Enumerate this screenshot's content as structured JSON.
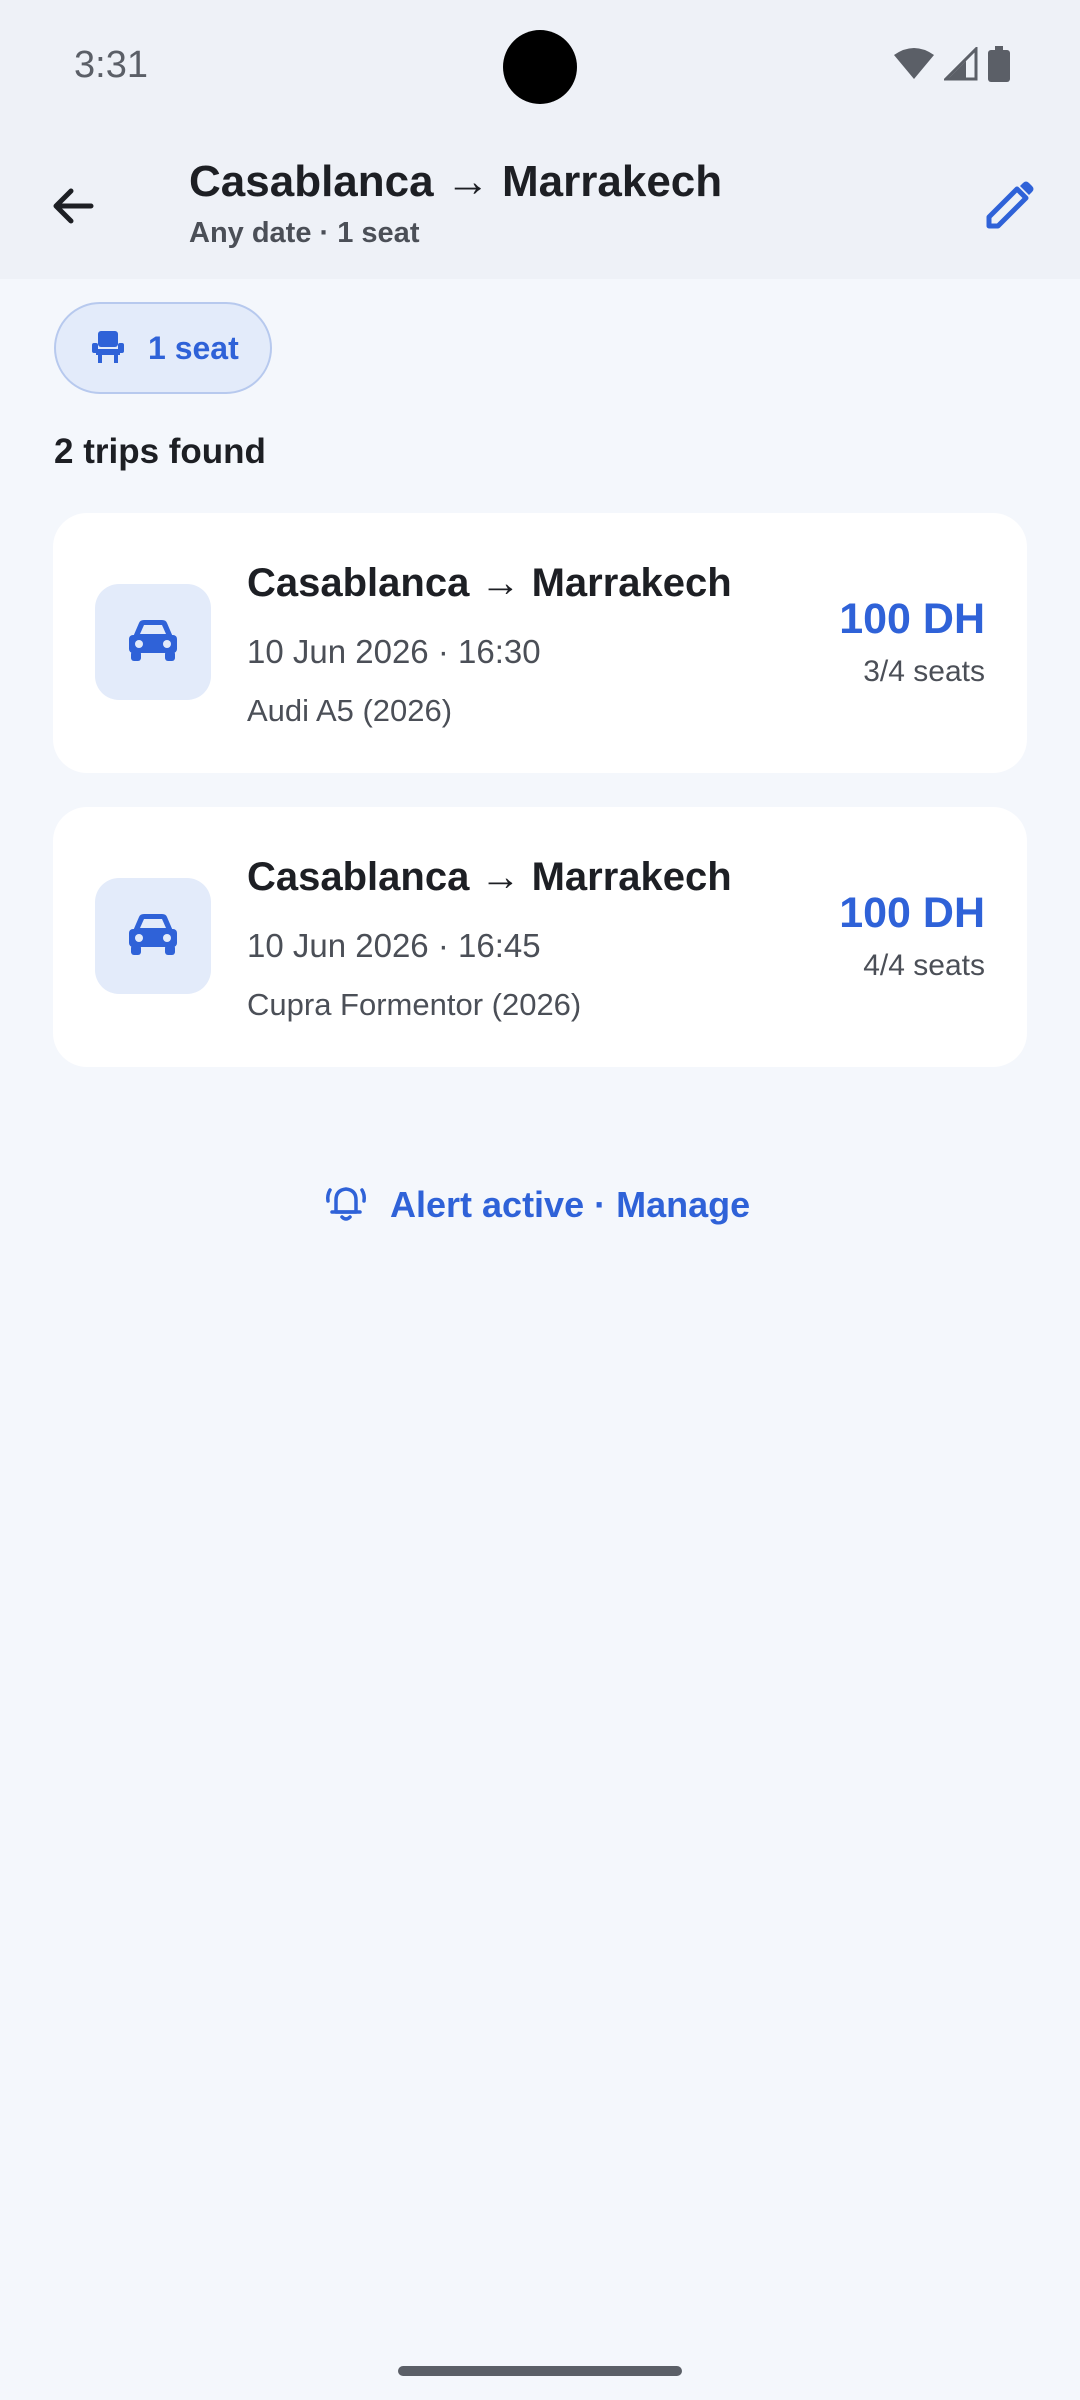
{
  "status_bar": {
    "time": "3:31",
    "icons": [
      "wifi-icon",
      "cellular-signal-icon",
      "battery-icon"
    ]
  },
  "app_bar": {
    "title": "Casablanca → Marrakech",
    "subtitle": "Any date · 1 seat",
    "back_icon": "arrow-back-icon",
    "edit_icon": "pencil-icon"
  },
  "filter_chip": {
    "label": "1 seat",
    "icon": "seat-icon"
  },
  "results": {
    "count_label": "2 trips found",
    "trips": [
      {
        "route": "Casablanca → Marrakech",
        "datetime": "10 Jun 2026 · 16:30",
        "car": "Audi A5 (2026)",
        "price": "100 DH",
        "seats": "3/4 seats",
        "icon": "car-icon"
      },
      {
        "route": "Casablanca → Marrakech",
        "datetime": "10 Jun 2026 · 16:45",
        "car": "Cupra Formentor (2026)",
        "price": "100 DH",
        "seats": "4/4 seats",
        "icon": "car-icon"
      }
    ]
  },
  "alert": {
    "label": "Alert active · Manage",
    "icon": "bell-ringing-icon"
  },
  "colors": {
    "accent": "#2f62d8",
    "background": "#f4f7fc",
    "app_bar": "#eef1f7",
    "card": "#ffffff",
    "icon_tile": "#e3ebfa"
  }
}
